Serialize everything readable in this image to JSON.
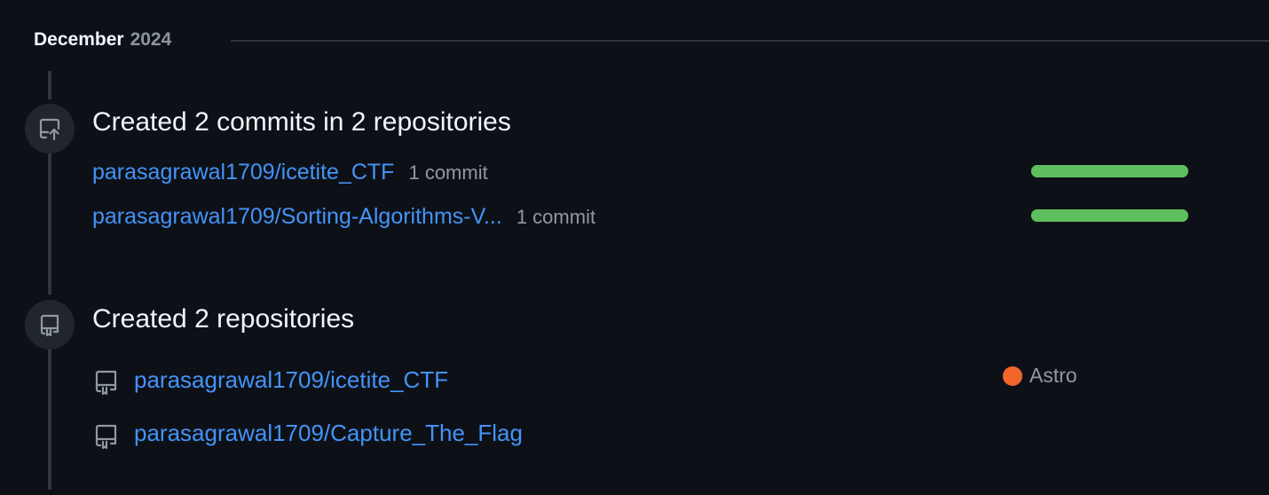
{
  "header": {
    "month": "December",
    "year": "2024"
  },
  "commits_section": {
    "title": "Created 2 commits in 2 repositories",
    "icon": "repo-push-icon",
    "repos": [
      {
        "name": "parasagrawal1709/icetite_CTF",
        "count_label": "1 commit",
        "bar_fraction": 1.0
      },
      {
        "name": "parasagrawal1709/Sorting-Algorithms-V...",
        "count_label": "1 commit",
        "bar_fraction": 1.0
      }
    ]
  },
  "repos_section": {
    "title": "Created 2 repositories",
    "icon": "repo-icon",
    "repos": [
      {
        "name": "parasagrawal1709/icetite_CTF",
        "language": "Astro",
        "language_color": "#f1662a"
      },
      {
        "name": "parasagrawal1709/Capture_The_Flag"
      }
    ]
  },
  "colors": {
    "background": "#0d1117",
    "link": "#4493f8",
    "bar": "#5fbf5f",
    "muted": "#9198a1"
  }
}
